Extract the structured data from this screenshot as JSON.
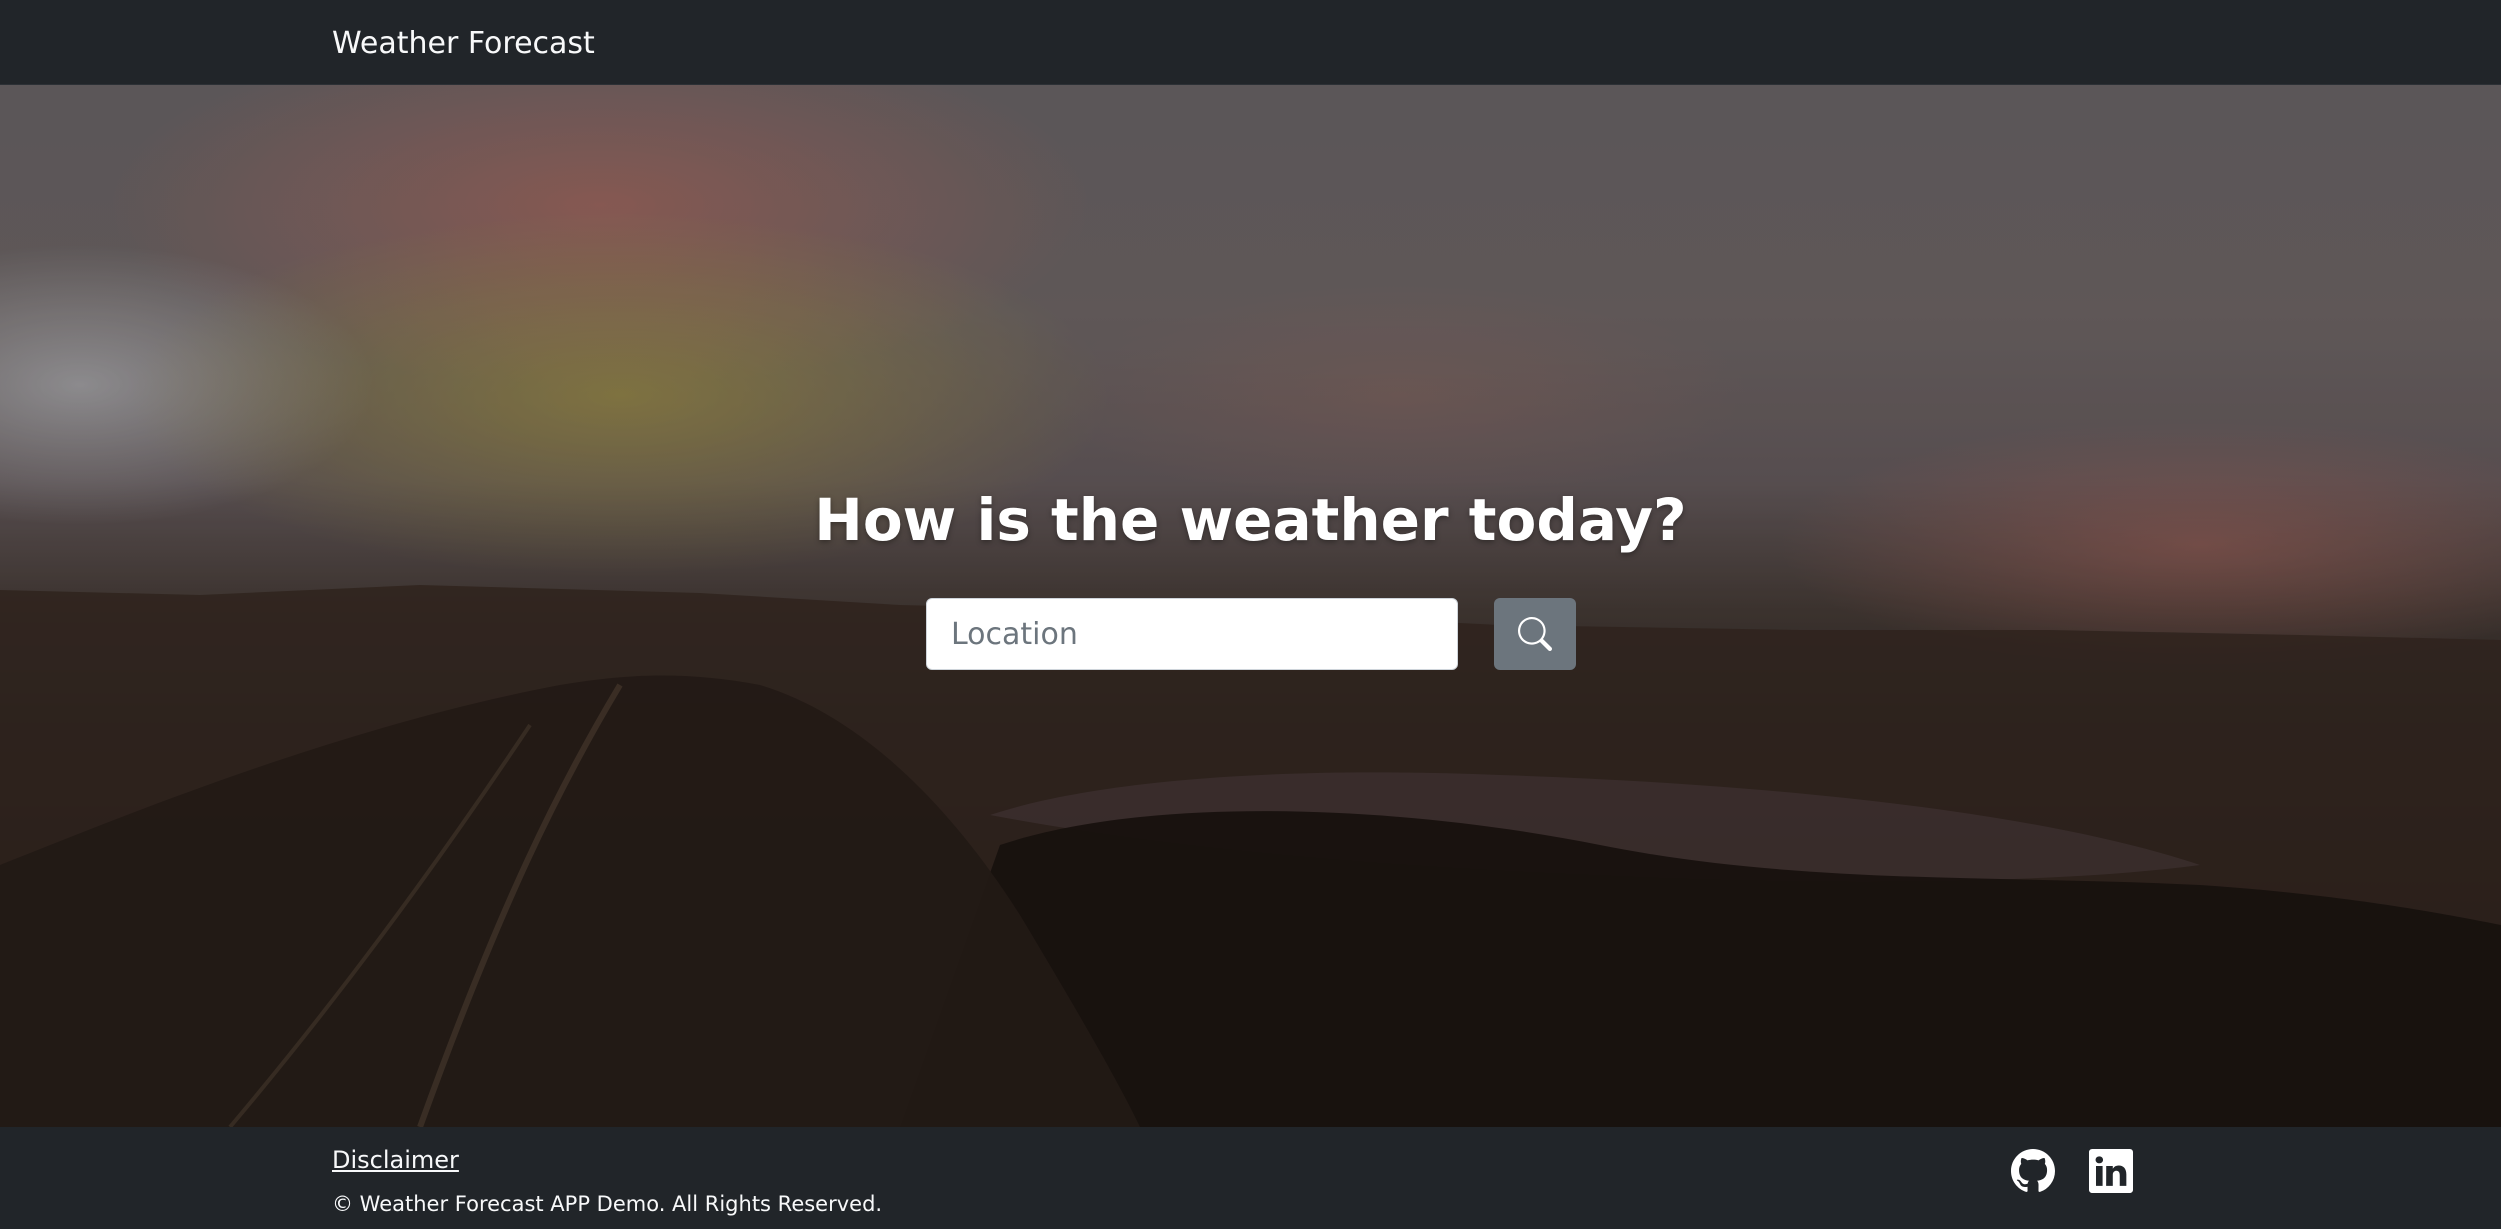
{
  "navbar": {
    "brand": "Weather Forecast"
  },
  "hero": {
    "headline": "How is the weather today?",
    "search": {
      "placeholder": "Location",
      "value": "",
      "button_icon": "search-icon"
    }
  },
  "footer": {
    "disclaimer": "Disclaimer",
    "copyright": "© Weather Forecast APP Demo. All Rights Reserved.",
    "social": [
      {
        "icon": "github-icon"
      },
      {
        "icon": "linkedin-icon"
      }
    ]
  },
  "colors": {
    "navbar_bg": "#212529",
    "footer_bg": "#212529",
    "button_bg": "#6c757d",
    "text_light": "#f8f9fa"
  }
}
